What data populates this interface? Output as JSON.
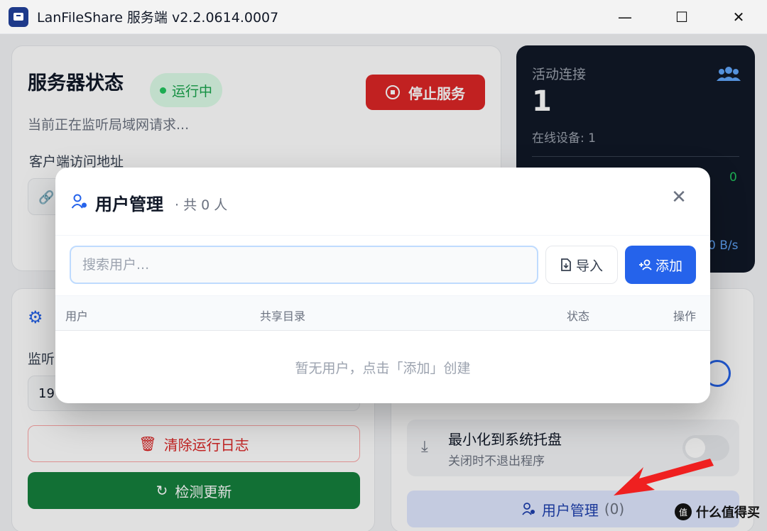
{
  "window": {
    "title": "LanFileShare 服务端 v2.2.0614.0007",
    "minimize": "—",
    "maximize": "☐",
    "close": "✕"
  },
  "status": {
    "title": "服务器状态",
    "badge": "运行中",
    "subtitle": "当前正在监听局域网请求...",
    "stop_button": "停止服务",
    "address_label": "客户端访问地址"
  },
  "connections": {
    "title": "活动连接",
    "count": "1",
    "online": "在线设备: 1",
    "value2": "0",
    "rate": "0 B/s"
  },
  "settings": {
    "listen_label": "监听",
    "ip_partial": "19",
    "clear_log_button": "清除运行日志",
    "check_update_button": "检测更新"
  },
  "options": {
    "tray_title": "最小化到系统托盘",
    "tray_subtitle": "关闭时不退出程序",
    "user_mgmt_button": "用户管理",
    "user_mgmt_count": "(0)"
  },
  "modal": {
    "title": "用户管理",
    "count": "· 共 0 人",
    "search_placeholder": "搜索用户...",
    "import_button": "导入",
    "add_button": "添加",
    "columns": [
      "用户",
      "共享目录",
      "状态",
      "操作"
    ],
    "empty_message": "暂无用户，点击「添加」创建"
  },
  "watermark": {
    "icon": "值",
    "text": "什么值得买"
  },
  "colors": {
    "primary": "#2563eb",
    "danger": "#dc2626",
    "success": "#15803d",
    "dark_card": "#111827"
  }
}
